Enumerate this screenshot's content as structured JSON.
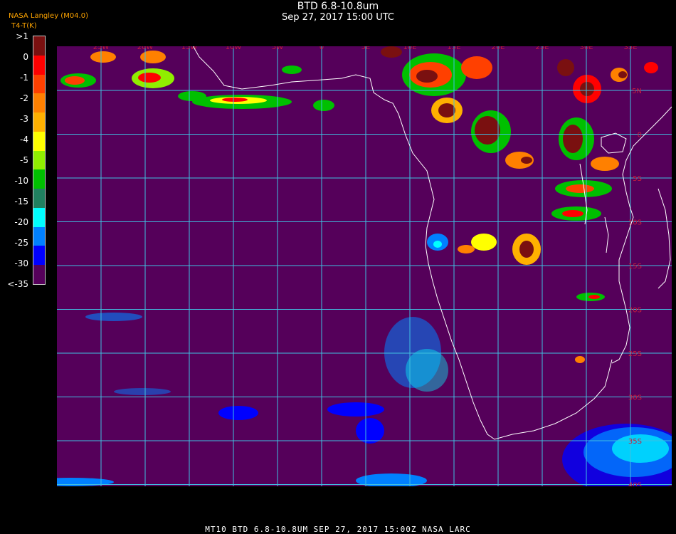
{
  "header": {
    "title": "BTD 6.8-10.8um",
    "timestamp": "Sep 27, 2017 15:00 UTC",
    "source_line1": "NASA Langley (M04.0)",
    "source_line2": "T4-T(K)",
    "overlay_text": "BTD"
  },
  "colorbar": {
    "labels": [
      ">1",
      "0",
      "-1",
      "-2",
      "-3",
      "-4",
      "-5",
      "-10",
      "-15",
      "-20",
      "-25",
      "-30",
      "<-35"
    ],
    "colors": [
      "#7a1010",
      "#ff0000",
      "#ff4000",
      "#ff8000",
      "#ffb000",
      "#ffff00",
      "#90ee00",
      "#00c000",
      "#208060",
      "#00ffff",
      "#0080ff",
      "#0000ff",
      "#55005a"
    ]
  },
  "map": {
    "background_color": "#55005a",
    "grid_color": "#40c0e0",
    "coast_color": "#ffffff",
    "lon_labels": [
      "25W",
      "20W",
      "15W",
      "10W",
      "5W",
      "0",
      "5E",
      "10E",
      "15E",
      "20E",
      "25E",
      "30E",
      "35E"
    ],
    "lat_labels": [
      "5N",
      "0",
      "5S",
      "10S",
      "15S",
      "20S",
      "25S",
      "30S",
      "35S",
      "40S"
    ]
  },
  "footer": {
    "text": "MT10  BTD 6.8-10.8UM   SEP 27, 2017 15:00Z   NASA LARC"
  }
}
